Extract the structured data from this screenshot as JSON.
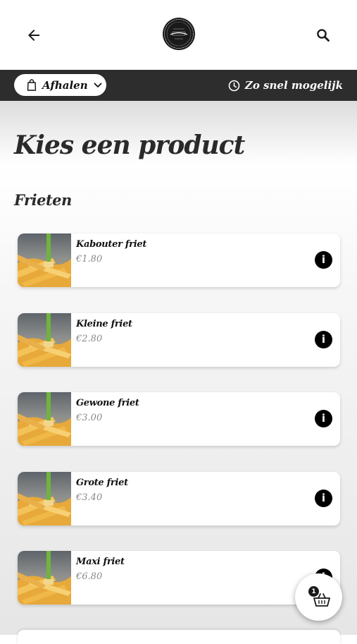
{
  "header": {
    "back_icon": "arrow-left-icon",
    "search_icon": "search-icon",
    "logo": "restaurant-logo"
  },
  "order_bar": {
    "mode_label": "Afhalen",
    "mode_icon": "shopping-bag-icon",
    "time_label": "Zo snel mogelijk",
    "time_icon": "clock-icon"
  },
  "page": {
    "title": "Kies een product",
    "section": "Frieten"
  },
  "products": [
    {
      "name": "Kabouter friet",
      "price": "€1.80"
    },
    {
      "name": "Kleine friet",
      "price": "€2.80"
    },
    {
      "name": "Gewone friet",
      "price": "€3.00"
    },
    {
      "name": "Grote friet",
      "price": "€3.40"
    },
    {
      "name": "Maxi friet",
      "price": "€6.80"
    }
  ],
  "cart": {
    "count": "1",
    "icon": "basket-icon"
  },
  "colors": {
    "dark_bar": "#2d2d2d",
    "text": "#2a2a2a",
    "price": "#8a8a8a"
  }
}
